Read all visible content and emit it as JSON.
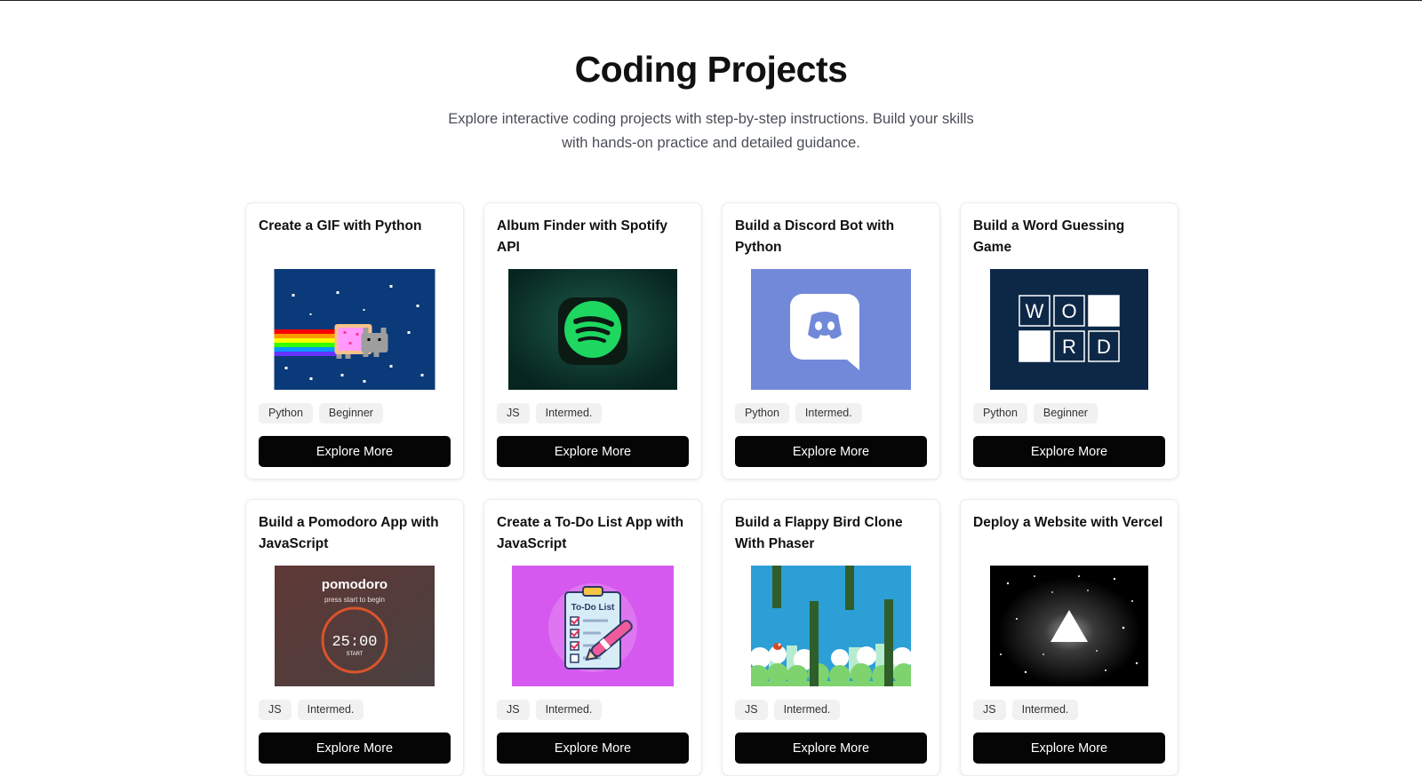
{
  "header": {
    "title": "Coding Projects",
    "subtitle_line1": "Explore interactive coding projects with step-by-step instructions. Build your skills",
    "subtitle_line2": "with hands-on practice and detailed guidance."
  },
  "projects": [
    {
      "title": "Create a GIF with Python",
      "image": "nyan-cat-image",
      "tags": [
        "Python",
        "Beginner"
      ],
      "button": "Explore More"
    },
    {
      "title": "Album Finder with Spotify API",
      "image": "spotify-logo-image",
      "tags": [
        "JS",
        "Intermed."
      ],
      "button": "Explore More"
    },
    {
      "title": "Build a Discord Bot with Python",
      "image": "discord-logo-image",
      "tags": [
        "Python",
        "Intermed."
      ],
      "button": "Explore More"
    },
    {
      "title": "Build a Word Guessing Game",
      "image": "word-tiles-image",
      "tags": [
        "Python",
        "Beginner"
      ],
      "button": "Explore More",
      "tiles": [
        "W",
        "O",
        "",
        "",
        "R",
        "D"
      ]
    },
    {
      "title": "Build a Pomodoro App with JavaScript",
      "image": "pomodoro-timer-image",
      "tags": [
        "JS",
        "Intermed."
      ],
      "button": "Explore More",
      "pomodoro": {
        "name": "pomodoro",
        "hint": "press start to begin",
        "time": "25:00",
        "action": "START"
      }
    },
    {
      "title": "Create a To-Do List App with JavaScript",
      "image": "todo-clipboard-image",
      "tags": [
        "JS",
        "Intermed."
      ],
      "button": "Explore More",
      "clipboard_label": "To-Do List"
    },
    {
      "title": "Build a Flappy Bird Clone With Phaser",
      "image": "flappy-bird-image",
      "tags": [
        "JS",
        "Intermed."
      ],
      "button": "Explore More"
    },
    {
      "title": "Deploy a Website with Vercel",
      "image": "vercel-triangle-image",
      "tags": [
        "JS",
        "Intermed."
      ],
      "button": "Explore More"
    }
  ],
  "colors": {
    "button_bg": "#050505",
    "tag_bg": "#f1f1f1",
    "nyan_bg": "#0b3a7a",
    "spotify_bg": "#0e3b33",
    "spotify_green": "#1ed760",
    "discord_bg": "#7289da",
    "word_bg": "#0d2847",
    "pomodoro_bg": "#5a3a37",
    "pomodoro_ring": "#d9542b",
    "todo_bg": "#d659ef",
    "flappy_sky": "#2b9fd6",
    "vercel_bg": "#000000"
  }
}
